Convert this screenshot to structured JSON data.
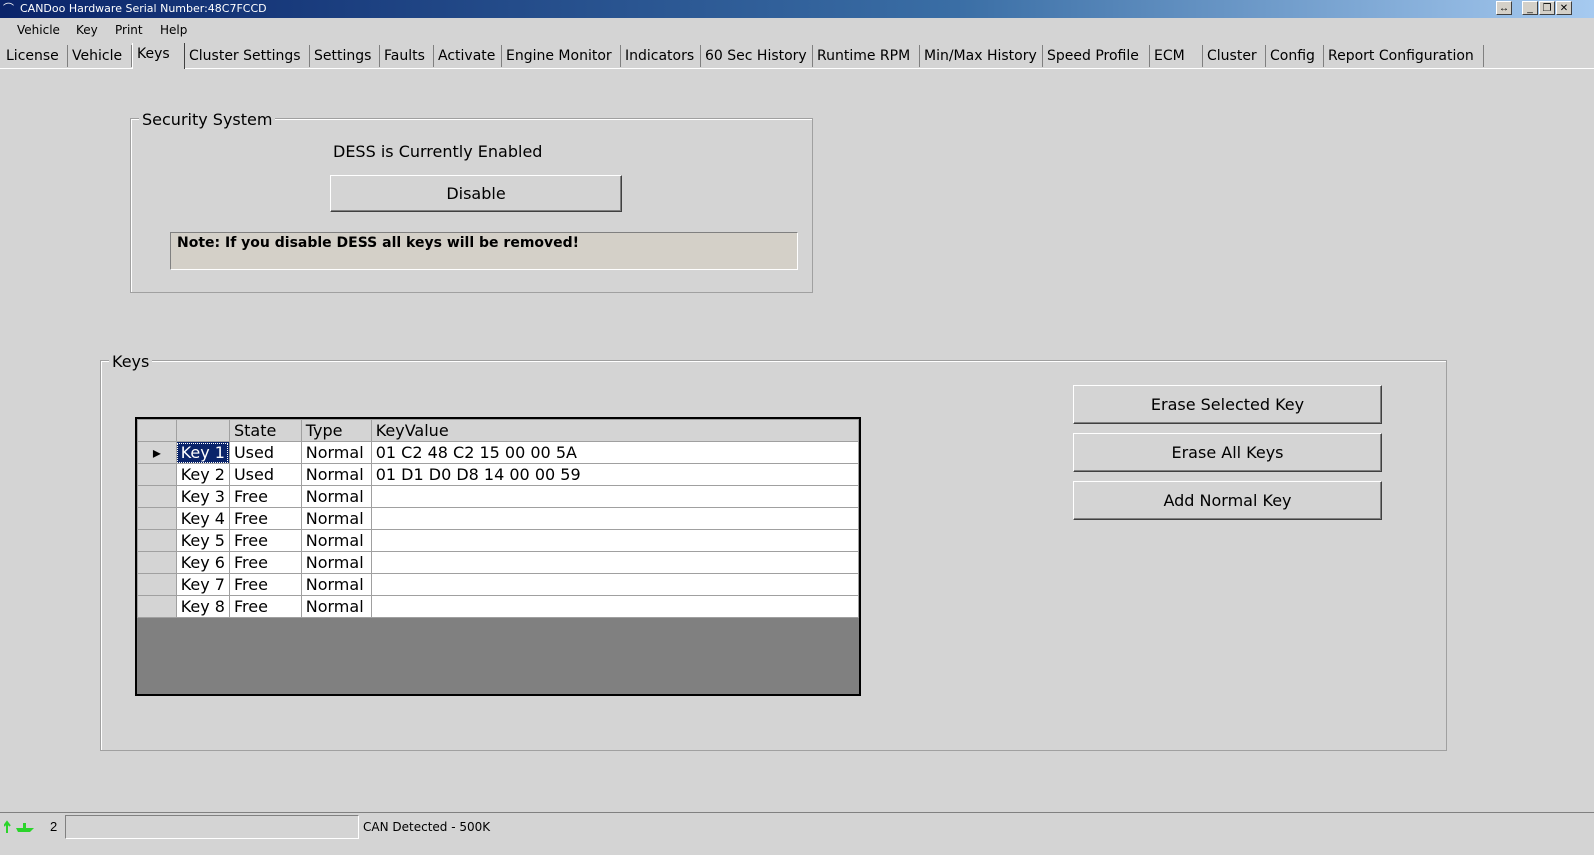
{
  "window": {
    "title": "CANDoo  Hardware Serial Number:48C7FCCD",
    "buttons": [
      "↔",
      "_",
      "❐",
      "✕"
    ]
  },
  "menu": [
    "Vehicle",
    "Key",
    "Print",
    "Help"
  ],
  "tabs": [
    {
      "label": "License"
    },
    {
      "label": "Vehicle"
    },
    {
      "label": "Keys",
      "active": true
    },
    {
      "label": "Cluster Settings"
    },
    {
      "label": "Settings"
    },
    {
      "label": "Faults"
    },
    {
      "label": "Activate"
    },
    {
      "label": "Engine Monitor"
    },
    {
      "label": "Indicators"
    },
    {
      "label": "60 Sec History"
    },
    {
      "label": "Runtime RPM"
    },
    {
      "label": "Min/Max History"
    },
    {
      "label": "Speed Profile"
    },
    {
      "label": "ECM"
    },
    {
      "label": "Cluster"
    },
    {
      "label": "Config"
    },
    {
      "label": "Report Configuration"
    }
  ],
  "security": {
    "legend": "Security System",
    "status": "DESS is Currently Enabled",
    "disable_label": "Disable",
    "note": "Note: If you disable DESS all keys will be removed!"
  },
  "keys": {
    "legend": "Keys",
    "columns": [
      "",
      "State",
      "Type",
      "KeyValue"
    ],
    "rows": [
      {
        "name": "Key 1",
        "state": "Used",
        "type": "Normal",
        "value": "01 C2 48 C2 15 00 00 5A",
        "selected": true
      },
      {
        "name": "Key 2",
        "state": "Used",
        "type": "Normal",
        "value": "01 D1 D0 D8 14 00 00 59"
      },
      {
        "name": "Key 3",
        "state": "Free",
        "type": "Normal",
        "value": ""
      },
      {
        "name": "Key 4",
        "state": "Free",
        "type": "Normal",
        "value": ""
      },
      {
        "name": "Key 5",
        "state": "Free",
        "type": "Normal",
        "value": ""
      },
      {
        "name": "Key 6",
        "state": "Free",
        "type": "Normal",
        "value": ""
      },
      {
        "name": "Key 7",
        "state": "Free",
        "type": "Normal",
        "value": ""
      },
      {
        "name": "Key 8",
        "state": "Free",
        "type": "Normal",
        "value": ""
      }
    ],
    "erase_selected_label": "Erase Selected  Key",
    "erase_all_label": "Erase All Keys",
    "add_normal_label": "Add Normal Key"
  },
  "status": {
    "count": "2",
    "message": "CAN Detected - 500K"
  }
}
